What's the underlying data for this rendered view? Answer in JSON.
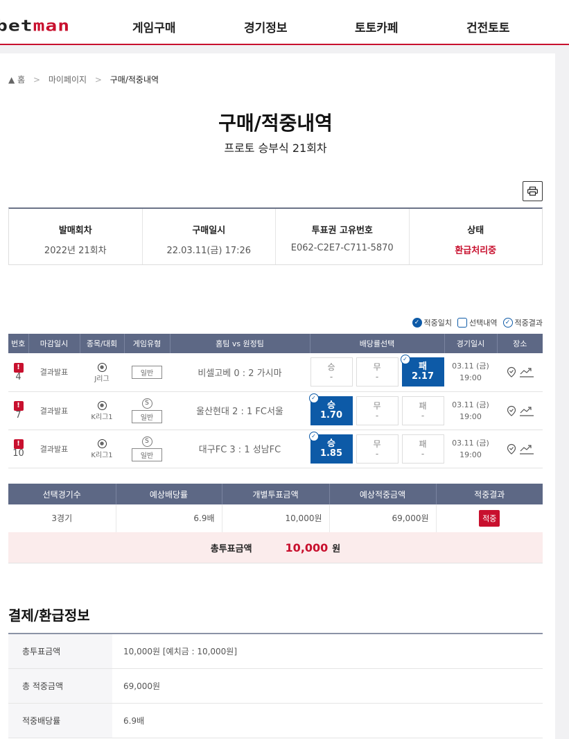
{
  "header": {
    "logo_main": "bet",
    "logo_accent": "man",
    "nav": [
      "게임구매",
      "경기정보",
      "토토카페",
      "건전토토"
    ]
  },
  "breadcrumb": {
    "home": "홈",
    "mypage": "마이페이지",
    "current": "구매/적중내역"
  },
  "page": {
    "title": "구매/적중내역",
    "subtitle": "프로토 승부식 21회차"
  },
  "info": {
    "round_label": "발매회차",
    "round_value": "2022년 21회차",
    "date_label": "구매일시",
    "date_value": "22.03.11(금) 17:26",
    "ticket_label": "투표권 고유번호",
    "ticket_value": "E062-C2E7-C711-5870",
    "status_label": "상태",
    "status_value": "환급처리중"
  },
  "legend": {
    "hit_match": "적중일치",
    "selection": "선택내역",
    "hit_result": "적중결과"
  },
  "match_headers": [
    "번호",
    "마감일시",
    "종목/대회",
    "게임유형",
    "홈팀 vs 원정팀",
    "배당률선택",
    "경기일시",
    "장소"
  ],
  "matches": [
    {
      "no": "4",
      "close": "결과발표",
      "league": "J리그",
      "type": "일반",
      "teams": "비셀고베 0 : 2 가시마",
      "win_label": "승",
      "win_odd": "-",
      "draw_label": "무",
      "draw_odd": "-",
      "lose_label": "패",
      "lose_odd": "2.17",
      "date": "03.11 (금)",
      "time": "19:00"
    },
    {
      "no": "7",
      "close": "결과발표",
      "league": "K리그1",
      "type": "일반",
      "type_mark": "S",
      "teams": "울산현대 2 : 1 FC서울",
      "win_label": "승",
      "win_odd": "1.70",
      "draw_label": "무",
      "draw_odd": "-",
      "lose_label": "패",
      "lose_odd": "-",
      "date": "03.11 (금)",
      "time": "19:00"
    },
    {
      "no": "10",
      "close": "결과발표",
      "league": "K리그1",
      "type": "일반",
      "type_mark": "S",
      "teams": "대구FC 3 : 1 성남FC",
      "win_label": "승",
      "win_odd": "1.85",
      "draw_label": "무",
      "draw_odd": "-",
      "lose_label": "패",
      "lose_odd": "-",
      "date": "03.11 (금)",
      "time": "19:00"
    }
  ],
  "summary": {
    "headers": [
      "선택경기수",
      "예상배당률",
      "개별투표금액",
      "예상적중금액",
      "적중결과"
    ],
    "games": "3경기",
    "odds": "6.9배",
    "stake": "10,000원",
    "expected": "69,000원",
    "result": "적중",
    "total_label": "총투표금액",
    "total_value": "10,000",
    "total_unit": "원"
  },
  "payment": {
    "title": "결제/환급정보",
    "rows": [
      {
        "k": "총투표금액",
        "v": "10,000원 [예치금 : 10,000원]"
      },
      {
        "k": "총 적중금액",
        "v": "69,000원"
      },
      {
        "k": "적중배당률",
        "v": "6.9배"
      }
    ]
  },
  "colors": {
    "brand_red": "#c8102e",
    "selected_blue": "#0d5aa7",
    "table_header": "#5d6885"
  }
}
